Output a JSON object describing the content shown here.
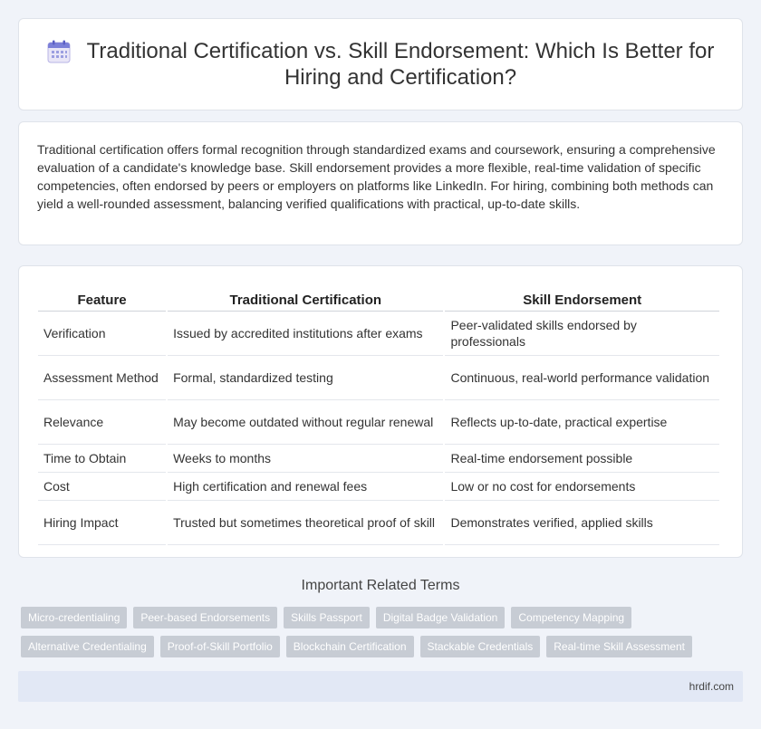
{
  "header": {
    "title": "Traditional Certification vs. Skill Endorsement: Which Is Better for Hiring and Certification?",
    "icon": "calendar-icon"
  },
  "summary": {
    "text": "Traditional certification offers formal recognition through standardized exams and coursework, ensuring a comprehensive evaluation of a candidate's knowledge base. Skill endorsement provides a more flexible, real-time validation of specific competencies, often endorsed by peers or employers on platforms like LinkedIn. For hiring, combining both methods can yield a well-rounded assessment, balancing verified qualifications with practical, up-to-date skills."
  },
  "table": {
    "headers": [
      "Feature",
      "Traditional Certification",
      "Skill Endorsement"
    ],
    "rows": [
      [
        "Verification",
        "Issued by accredited institutions after exams",
        "Peer-validated skills endorsed by professionals"
      ],
      [
        "Assessment Method",
        "Formal, standardized testing",
        "Continuous, real-world performance validation"
      ],
      [
        "Relevance",
        "May become outdated without regular renewal",
        "Reflects up-to-date, practical expertise"
      ],
      [
        "Time to Obtain",
        "Weeks to months",
        "Real-time endorsement possible"
      ],
      [
        "Cost",
        "High certification and renewal fees",
        "Low or no cost for endorsements"
      ],
      [
        "Hiring Impact",
        "Trusted but sometimes theoretical proof of skill",
        "Demonstrates verified, applied skills"
      ]
    ]
  },
  "related": {
    "title": "Important Related Terms",
    "tags_row1": [
      "Micro-credentialing",
      "Peer-based Endorsements",
      "Skills Passport",
      "Digital Badge Validation",
      "Competency Mapping"
    ],
    "tags_row2": [
      "Alternative Credentialing",
      "Proof-of-Skill Portfolio",
      "Blockchain Certification",
      "Stackable Credentials",
      "Real-time Skill Assessment"
    ]
  },
  "footer": {
    "site": "hrdif.com"
  },
  "colors": {
    "accent": "#6a6fd1",
    "tag_bg": "#c7ccd4",
    "footer_bg": "#e2e8f5",
    "page_bg": "#f0f3f9"
  }
}
